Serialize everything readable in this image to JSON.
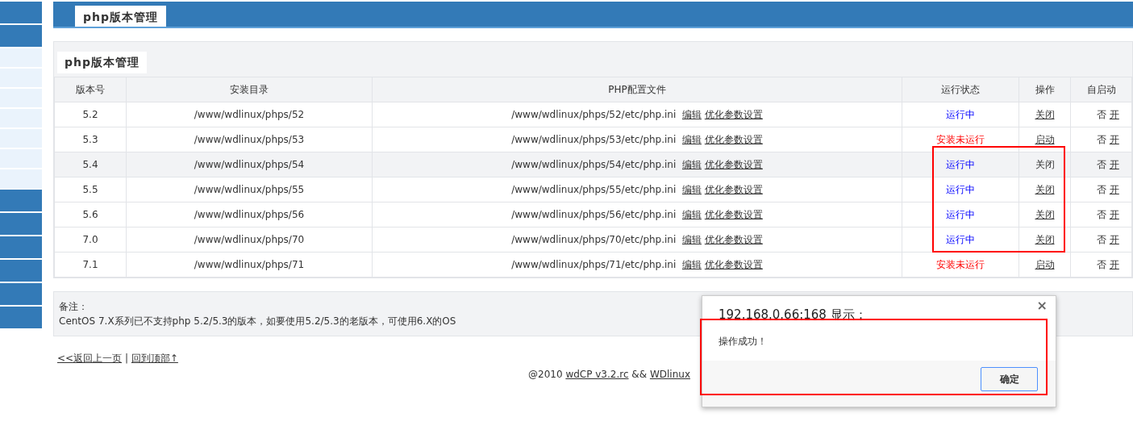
{
  "sidebar": {
    "items": [
      {
        "kind": "dark"
      },
      {
        "kind": "dark"
      },
      {
        "kind": "light"
      },
      {
        "kind": "light"
      },
      {
        "kind": "light"
      },
      {
        "kind": "light"
      },
      {
        "kind": "light"
      },
      {
        "kind": "light"
      },
      {
        "kind": "light"
      },
      {
        "kind": "dark"
      },
      {
        "kind": "dark"
      },
      {
        "kind": "dark"
      },
      {
        "kind": "dark"
      },
      {
        "kind": "dark"
      },
      {
        "kind": "dark"
      }
    ]
  },
  "header": {
    "tab": "php版本管理"
  },
  "panel": {
    "title": "php版本管理",
    "table": {
      "columns": [
        "版本号",
        "安装目录",
        "PHP配置文件",
        "运行状态",
        "操作",
        "自启动"
      ],
      "rows": [
        {
          "version": "5.2",
          "dir": "/www/wdlinux/phps/52",
          "config": "/www/wdlinux/phps/52/etc/php.ini",
          "edit": "编辑",
          "tune": "优化参数设置",
          "status": "运行中",
          "running": true,
          "action": "关闭",
          "autostart": "否",
          "enable": "开",
          "hovered": false
        },
        {
          "version": "5.3",
          "dir": "/www/wdlinux/phps/53",
          "config": "/www/wdlinux/phps/53/etc/php.ini",
          "edit": "编辑",
          "tune": "优化参数设置",
          "status": "安装未运行",
          "running": false,
          "action": "启动",
          "autostart": "否",
          "enable": "开",
          "hovered": false
        },
        {
          "version": "5.4",
          "dir": "/www/wdlinux/phps/54",
          "config": "/www/wdlinux/phps/54/etc/php.ini",
          "edit": "编辑",
          "tune": "优化参数设置",
          "status": "运行中",
          "running": true,
          "action": "关闭",
          "autostart": "否",
          "enable": "开",
          "hovered": true
        },
        {
          "version": "5.5",
          "dir": "/www/wdlinux/phps/55",
          "config": "/www/wdlinux/phps/55/etc/php.ini",
          "edit": "编辑",
          "tune": "优化参数设置",
          "status": "运行中",
          "running": true,
          "action": "关闭",
          "autostart": "否",
          "enable": "开",
          "hovered": false
        },
        {
          "version": "5.6",
          "dir": "/www/wdlinux/phps/56",
          "config": "/www/wdlinux/phps/56/etc/php.ini",
          "edit": "编辑",
          "tune": "优化参数设置",
          "status": "运行中",
          "running": true,
          "action": "关闭",
          "autostart": "否",
          "enable": "开",
          "hovered": false
        },
        {
          "version": "7.0",
          "dir": "/www/wdlinux/phps/70",
          "config": "/www/wdlinux/phps/70/etc/php.ini",
          "edit": "编辑",
          "tune": "优化参数设置",
          "status": "运行中",
          "running": true,
          "action": "关闭",
          "autostart": "否",
          "enable": "开",
          "hovered": false
        },
        {
          "version": "7.1",
          "dir": "/www/wdlinux/phps/71",
          "config": "/www/wdlinux/phps/71/etc/php.ini",
          "edit": "编辑",
          "tune": "优化参数设置",
          "status": "安装未运行",
          "running": false,
          "action": "启动",
          "autostart": "否",
          "enable": "开",
          "hovered": false
        }
      ]
    }
  },
  "note": {
    "label": "备注：",
    "text": "CentOS 7.X系列已不支持php 5.2/5.3的版本，如要使用5.2/5.3的老版本，可使用6.X的OS"
  },
  "nav_links": {
    "back": "<<返回上一页",
    "separator": "|",
    "top": "回到顶部↑"
  },
  "footer": {
    "prefix": "@2010",
    "product": "wdCP v3.2.rc",
    "joiner": "&&",
    "vendor": "WDlinux"
  },
  "dialog": {
    "title": "192.168.0.66:168 显示：",
    "close": "×",
    "message": "操作成功！",
    "ok": "确定"
  }
}
